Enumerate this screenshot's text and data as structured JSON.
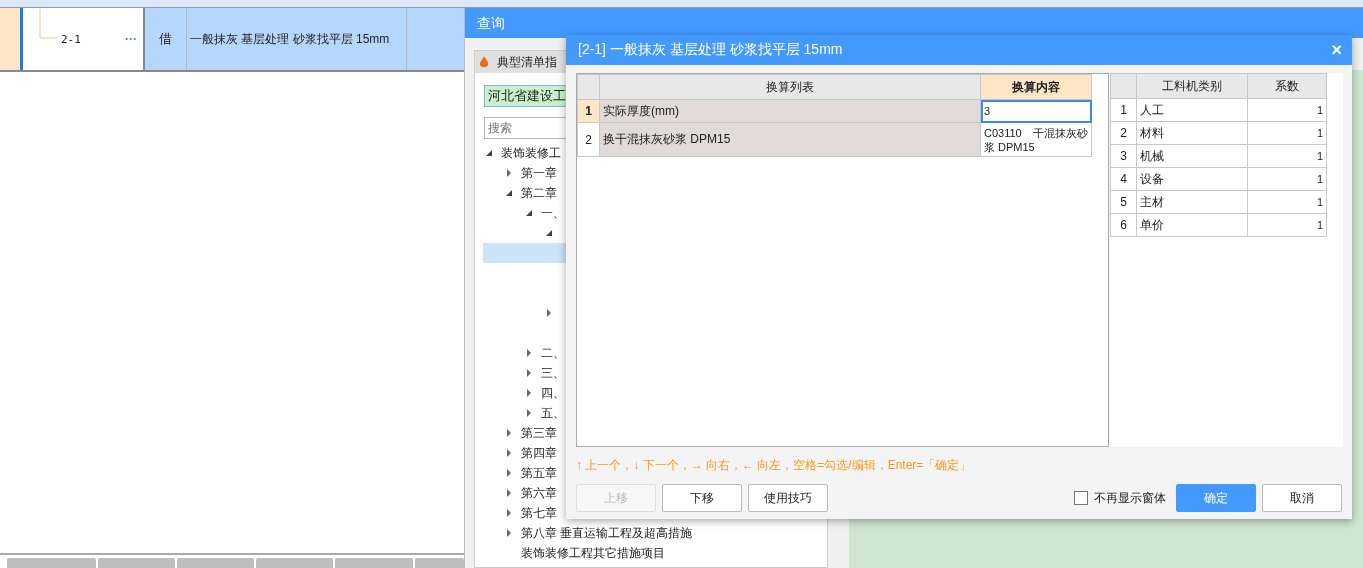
{
  "main_row": {
    "code": "2-1",
    "more": "···",
    "type": "借",
    "name": "一般抹灰 基层处理 砂浆找平层 15mm",
    "selected": true
  },
  "query_window": {
    "title": "查询",
    "panel_title": "典型清单指",
    "region_field": {
      "value": "河北省建设工"
    },
    "search": {
      "placeholder": "搜索"
    },
    "tree": [
      {
        "label": "装饰装修工",
        "expanded": true,
        "selected": false,
        "children": [
          {
            "label": "第一章",
            "expanded": false,
            "selected": false
          },
          {
            "label": "第二章",
            "expanded": true,
            "selected": false,
            "children": [
              {
                "label": "一、",
                "expanded": true,
                "selected": false,
                "children": [
                  {
                    "expanded": true,
                    "selected": false,
                    "children": [
                      {
                        "selected": true
                      },
                      {
                        "selected": false
                      },
                      {
                        "selected": false
                      }
                    ]
                  },
                  {
                    "expanded": false,
                    "selected": false
                  },
                  {
                    "selected": false
                  }
                ]
              },
              {
                "label": "二、",
                "expanded": false,
                "selected": false
              },
              {
                "label": "三、",
                "expanded": false,
                "selected": false
              },
              {
                "label": "四、",
                "expanded": false,
                "selected": false
              },
              {
                "label": "五、",
                "expanded": false,
                "selected": false
              }
            ]
          },
          {
            "label": "第三章",
            "expanded": false,
            "selected": false
          },
          {
            "label": "第四章",
            "expanded": false,
            "selected": false
          },
          {
            "label": "第五章",
            "expanded": false,
            "selected": false
          },
          {
            "label": "第六章",
            "expanded": false,
            "selected": false
          },
          {
            "label": "第七章",
            "expanded": false,
            "selected": false
          },
          {
            "label": "第八章 垂直运输工程及超高措施",
            "expanded": false,
            "selected": false
          },
          {
            "label": "装饰装修工程其它措施项目",
            "selected": false
          }
        ]
      }
    ]
  },
  "dialog": {
    "title": "[2-1] 一般抹灰 基层处理 砂浆找平层 15mm",
    "close": "×",
    "conversion_table": {
      "columns": [
        "换算列表",
        "换算内容"
      ],
      "rows": [
        {
          "index": "1",
          "item": "实际厚度(mm)",
          "value": "3",
          "selected": true
        },
        {
          "index": "2",
          "item": "换干混抹灰砂浆 DPM15",
          "value": "C03110　干混抹灰砂浆 DPM15",
          "selected": false
        }
      ]
    },
    "factor_table": {
      "columns": [
        "工料机类别",
        "系数"
      ],
      "rows": [
        {
          "index": "1",
          "category": "人工",
          "factor": "1"
        },
        {
          "index": "2",
          "category": "材料",
          "factor": "1"
        },
        {
          "index": "3",
          "category": "机械",
          "factor": "1"
        },
        {
          "index": "4",
          "category": "设备",
          "factor": "1"
        },
        {
          "index": "5",
          "category": "主材",
          "factor": "1"
        },
        {
          "index": "6",
          "category": "单价",
          "factor": "1"
        }
      ]
    },
    "hint": "↑ 上一个，↓ 下一个，→ 向右，← 向左，空格=勾选/编辑，Enter=「确定」",
    "buttons": [
      {
        "label": "上移",
        "disabled": true
      },
      {
        "label": "下移",
        "disabled": false
      },
      {
        "label": "使用技巧",
        "disabled": false
      }
    ],
    "dont_show_again": {
      "label": "不再显示窗体",
      "checked": false
    },
    "ok": "确定",
    "cancel": "取消"
  }
}
